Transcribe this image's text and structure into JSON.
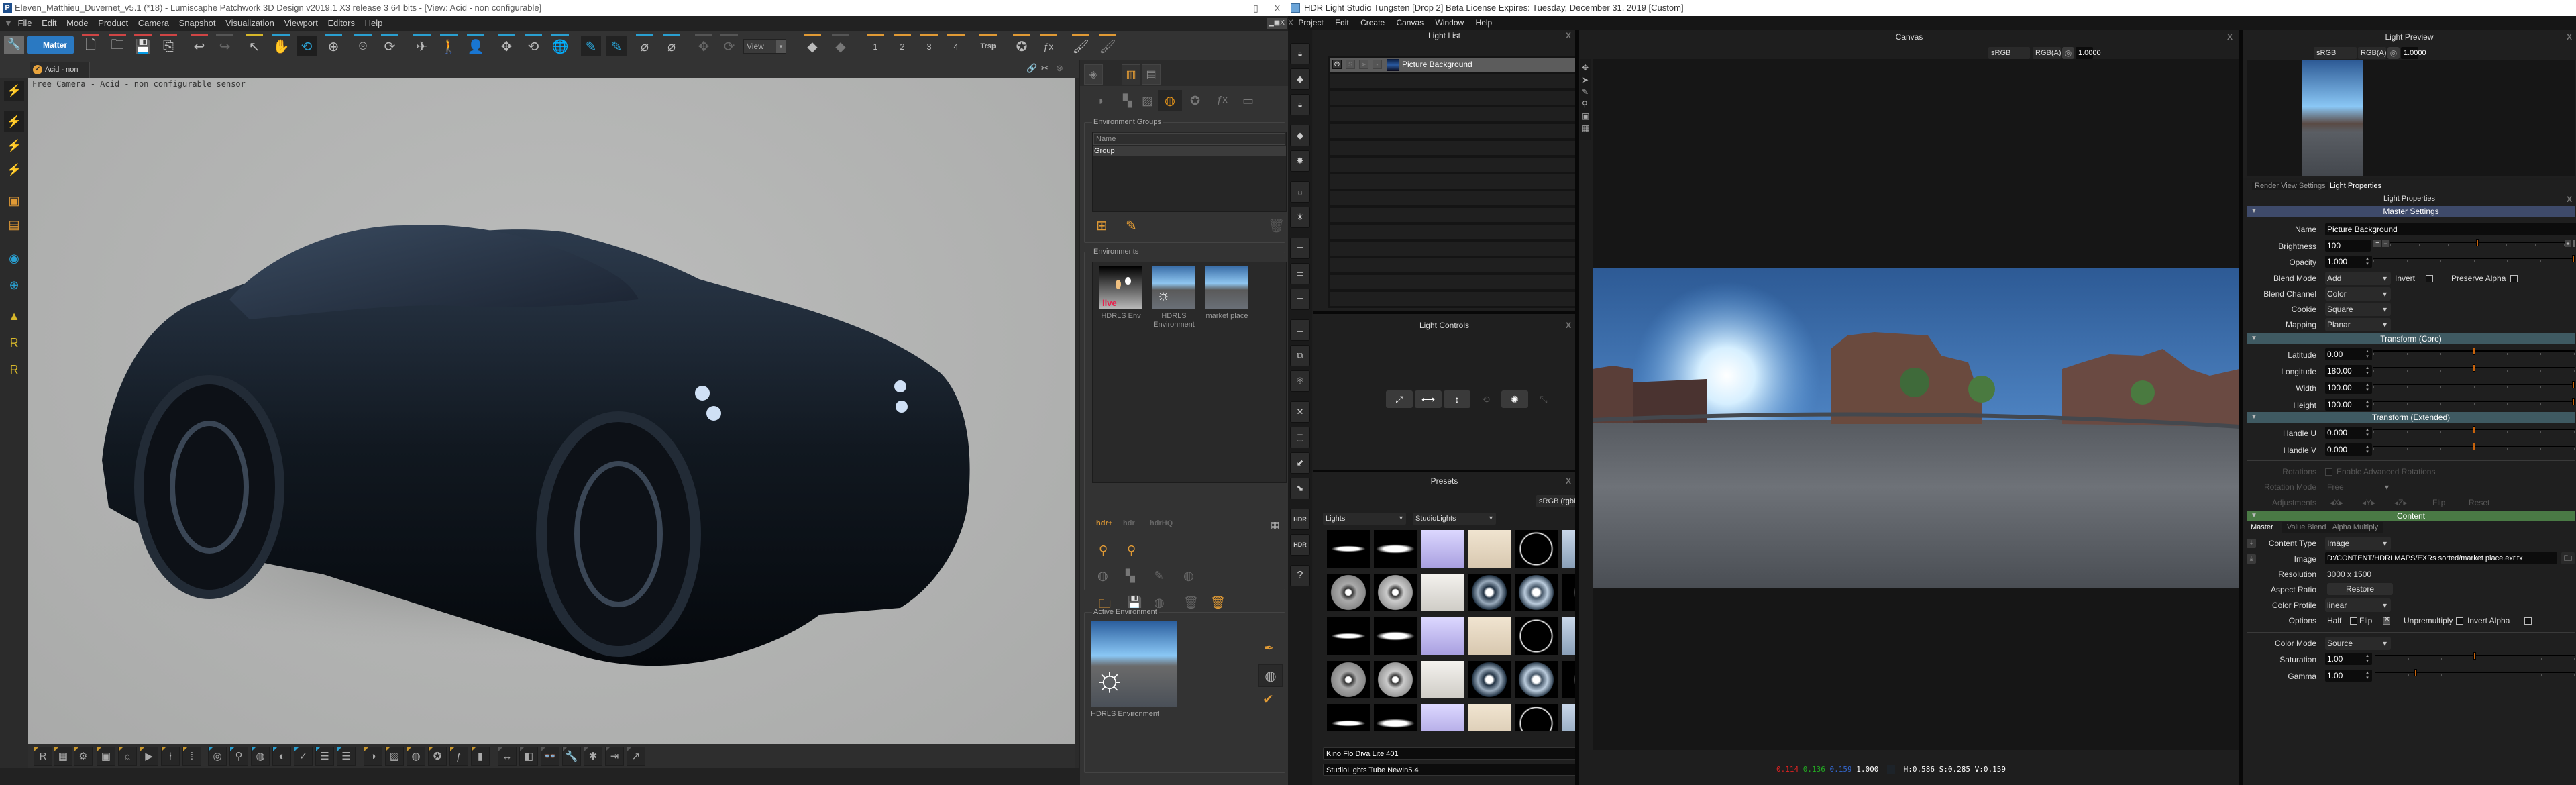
{
  "patchwork": {
    "window_title": "Eleven_Matthieu_Duvernet_v5.1 (*18) - Lumiscaphe Patchwork 3D Design v2019.1 X3 release 3  64 bits - [View: Acid - non configurable]",
    "window_controls": {
      "minimize": "–",
      "maximize": "▯",
      "close": "X"
    },
    "menu": [
      "File",
      "Edit",
      "Mode",
      "Product",
      "Camera",
      "Snapshot",
      "Visualization",
      "Viewport",
      "Editors",
      "Help"
    ],
    "toolbar": {
      "matter_label": "Matter",
      "view_select": "View",
      "trsp_label": "Trsp",
      "camera_slots": [
        "1",
        "2",
        "3",
        "4"
      ],
      "icons": [
        "new-file",
        "open-folder",
        "save",
        "save-as",
        "undo",
        "redo",
        "select-arrow",
        "hand-pan",
        "orbit",
        "zoom",
        "camera-target",
        "rotate",
        "fly",
        "walk",
        "character",
        "move",
        "rotate-object",
        "rotate-world",
        "paint-1",
        "paint-2",
        "hide-1",
        "hide-2"
      ]
    },
    "view_tab": "Acid - non configurable",
    "viewport_label": "Free Camera - Acid - non configurable sensor",
    "accent_colors": {
      "orange": "#e09a35",
      "blue": "#2a9fd0",
      "red": "#d04545",
      "yellow": "#d6b72a",
      "gray": "#555555"
    },
    "right_panel": {
      "top_tabs": [
        "kits",
        "library",
        "library-archive"
      ],
      "category_icons": [
        "materials",
        "textures",
        "images",
        "environments",
        "decals",
        "post-fx",
        "backplates"
      ],
      "environment_groups": {
        "title": "Environment Groups",
        "column": "Name",
        "rows": [
          "Group"
        ]
      },
      "environments": {
        "title": "Environments",
        "items": [
          {
            "label": "HDRLS Env",
            "badge": "live"
          },
          {
            "label": "HDRLS Environment"
          },
          {
            "label": "market place"
          }
        ]
      },
      "active_environment": {
        "title": "Active Environment",
        "label": "HDRLS Environment"
      }
    }
  },
  "hdrls": {
    "window_title": "HDR Light Studio Tungsten [Drop 2] Beta License Expires: Tuesday, December 31, 2019  [Custom]",
    "menu": [
      "Project",
      "Edit",
      "Create",
      "Canvas",
      "Window",
      "Help"
    ],
    "light_list": {
      "title": "Light List",
      "close": "X",
      "lights": [
        {
          "name": "Picture Background",
          "state_buttons": [
            "on",
            "solo",
            "select",
            "lock"
          ]
        }
      ],
      "empty_rows": 14
    },
    "light_controls": {
      "title": "Light Controls",
      "close": "X",
      "buttons": [
        "scale",
        "width",
        "height",
        "rotate",
        "brightness",
        "stretch"
      ]
    },
    "presets": {
      "title": "Presets",
      "close": "X",
      "color_space": "sRGB (rgbMonitor)",
      "category": "Lights",
      "subcategory": "StudioLights",
      "selected_name": "Kino Flo Diva Lite 401",
      "selected_set": "StudioLights Tube NewIn5.4"
    },
    "canvas": {
      "title": "Canvas",
      "close": "X",
      "color_space": "sRGB (rgbMonitor)",
      "channels": "RGB(A)",
      "exposure": "1.0000",
      "readout": {
        "r": "0.114",
        "g": "0.136",
        "b": "0.159",
        "a": "1.000",
        "hsv": "H:0.586 S:0.285 V:0.159"
      }
    },
    "light_preview": {
      "title": "Light Preview",
      "close": "X",
      "color_space": "sRGB (rgbMonitor)",
      "channels": "RGB(A)",
      "exposure": "1.0000"
    },
    "properties": {
      "tabs": [
        "Render View Settings",
        "Light Properties"
      ],
      "active_tab": "Light Properties",
      "title": "Light Properties",
      "close": "X",
      "master_settings": {
        "header": "Master Settings",
        "name_label": "Name",
        "name": "Picture Background",
        "brightness_label": "Brightness",
        "brightness": "100",
        "brightness_pos": 0.5,
        "opacity_label": "Opacity",
        "opacity": "1.000",
        "opacity_pos": 1.0,
        "blend_mode_label": "Blend Mode",
        "blend_mode": "Add",
        "invert_label": "Invert",
        "invert": false,
        "preserve_alpha_label": "Preserve Alpha",
        "preserve_alpha": false,
        "blend_channel_label": "Blend Channel",
        "blend_channel": "Color",
        "cookie_label": "Cookie",
        "cookie": "Square",
        "mapping_label": "Mapping",
        "mapping": "Planar"
      },
      "transform_core": {
        "header": "Transform (Core)",
        "rows": [
          {
            "label": "Latitude",
            "value": "0.00",
            "pos": 0.5
          },
          {
            "label": "Longitude",
            "value": "180.00",
            "pos": 0.5
          },
          {
            "label": "Width",
            "value": "100.00",
            "pos": 1.0
          },
          {
            "label": "Height",
            "value": "100.00",
            "pos": 1.0
          }
        ]
      },
      "transform_extended": {
        "header": "Transform (Extended)",
        "rows": [
          {
            "label": "Handle U",
            "value": "0.000",
            "pos": 0.5
          },
          {
            "label": "Handle V",
            "value": "0.000",
            "pos": 0.5
          }
        ],
        "rotations_label": "Rotations",
        "enable_adv_rotations": "Enable Advanced Rotations",
        "rotation_mode_label": "Rotation Mode",
        "rotation_mode": "Free",
        "adjustments_label": "Adjustments",
        "adjust_x": "X",
        "adjust_y": "Y",
        "adjust_z": "Z",
        "flip": "Flip",
        "reset": "Reset"
      },
      "content": {
        "header": "Content",
        "subtabs": [
          "Master",
          "Value Blend",
          "Alpha Multiply"
        ],
        "content_type_label": "Content Type",
        "content_type": "Image",
        "image_label": "Image",
        "image_path": "D:/CONTENT/HDRI MAPS/EXRs sorted/market place.exr.tx",
        "resolution_label": "Resolution",
        "resolution": "3000 x 1500",
        "aspect_ratio_label": "Aspect Ratio",
        "restore": "Restore",
        "color_profile_label": "Color Profile",
        "color_profile": "linear",
        "options_label": "Options",
        "options": [
          {
            "label": "Half",
            "checked": false
          },
          {
            "label": "Flip",
            "checked": true
          },
          {
            "label": "Unpremultiply",
            "checked": false
          },
          {
            "label": "Invert Alpha",
            "checked": false
          }
        ],
        "color_mode_label": "Color Mode",
        "color_mode": "Source",
        "saturation_label": "Saturation",
        "saturation": "1.00",
        "saturation_pos": 0.5,
        "gamma_label": "Gamma",
        "gamma": "1.00",
        "gamma_pos": 0.2
      },
      "section_colors": {
        "master": "#3e4a6a",
        "transform": "#3f5a62",
        "content": "#4a7a45"
      }
    }
  }
}
